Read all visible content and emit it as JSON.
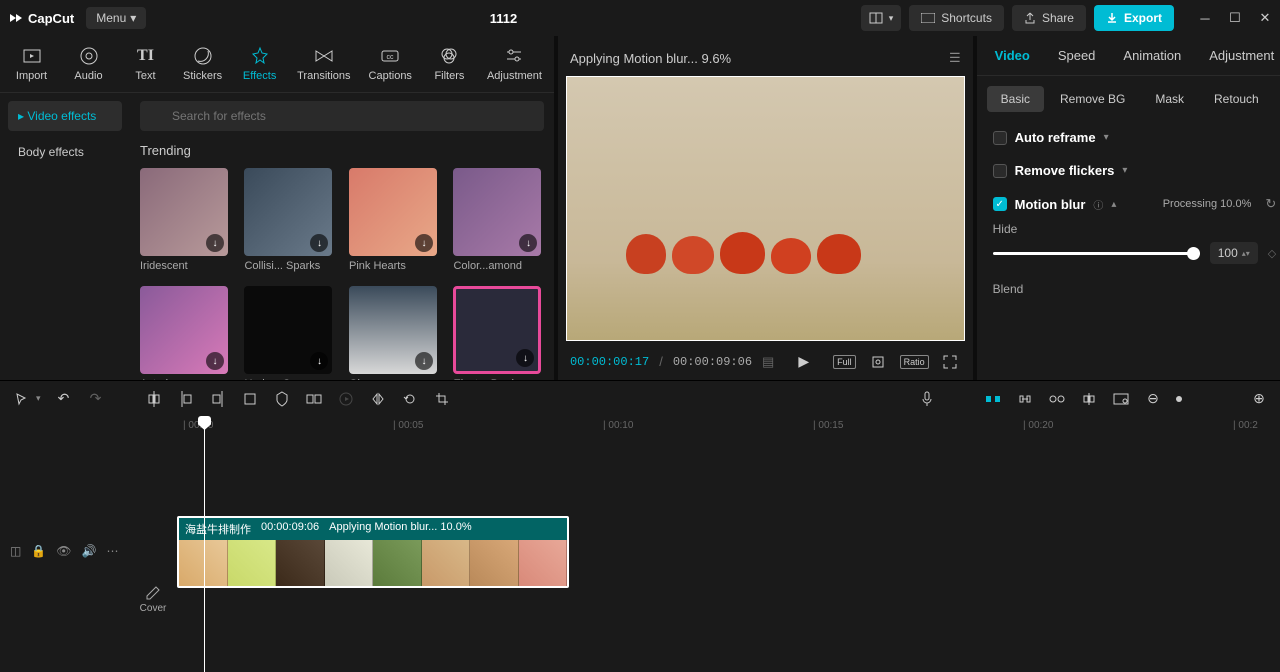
{
  "titlebar": {
    "logo": "CapCut",
    "menu": "Menu",
    "project_name": "1112",
    "shortcuts": "Shortcuts",
    "share": "Share",
    "export": "Export"
  },
  "nav": {
    "items": [
      {
        "label": "Import"
      },
      {
        "label": "Audio"
      },
      {
        "label": "Text"
      },
      {
        "label": "Stickers"
      },
      {
        "label": "Effects"
      },
      {
        "label": "Transitions"
      },
      {
        "label": "Captions"
      },
      {
        "label": "Filters"
      },
      {
        "label": "Adjustment"
      }
    ]
  },
  "effects_sidebar": {
    "video_effects": "Video effects",
    "body_effects": "Body effects"
  },
  "effects": {
    "search_placeholder": "Search for effects",
    "section": "Trending",
    "items": [
      {
        "name": "Iridescent"
      },
      {
        "name": "Collisi... Sparks"
      },
      {
        "name": "Pink Hearts"
      },
      {
        "name": "Color...amond"
      },
      {
        "name": "Astral"
      },
      {
        "name": "Horiz... Open"
      },
      {
        "name": "Glowworm"
      },
      {
        "name": "Electro Border"
      }
    ]
  },
  "preview": {
    "title": "Applying Motion blur... 9.6%",
    "current_time": "00:00:00:17",
    "total_time": "00:00:09:06",
    "full": "Full",
    "ratio": "Ratio"
  },
  "right_panel": {
    "tabs": [
      "Video",
      "Speed",
      "Animation",
      "Adjustment"
    ],
    "subtabs": [
      "Basic",
      "Remove BG",
      "Mask",
      "Retouch"
    ],
    "auto_reframe": "Auto reframe",
    "remove_flickers": "Remove flickers",
    "motion_blur": "Motion blur",
    "processing": "Processing 10.0%",
    "hide": "Hide",
    "hide_value": "100",
    "blend": "Blend"
  },
  "timeline": {
    "cover": "Cover",
    "ruler": [
      "00:00",
      "00:05",
      "00:10",
      "00:15",
      "00:20",
      "00:2"
    ],
    "clip": {
      "name": "海盐牛排制作",
      "duration": "00:00:09:06",
      "status": "Applying Motion blur... 10.0%"
    }
  }
}
